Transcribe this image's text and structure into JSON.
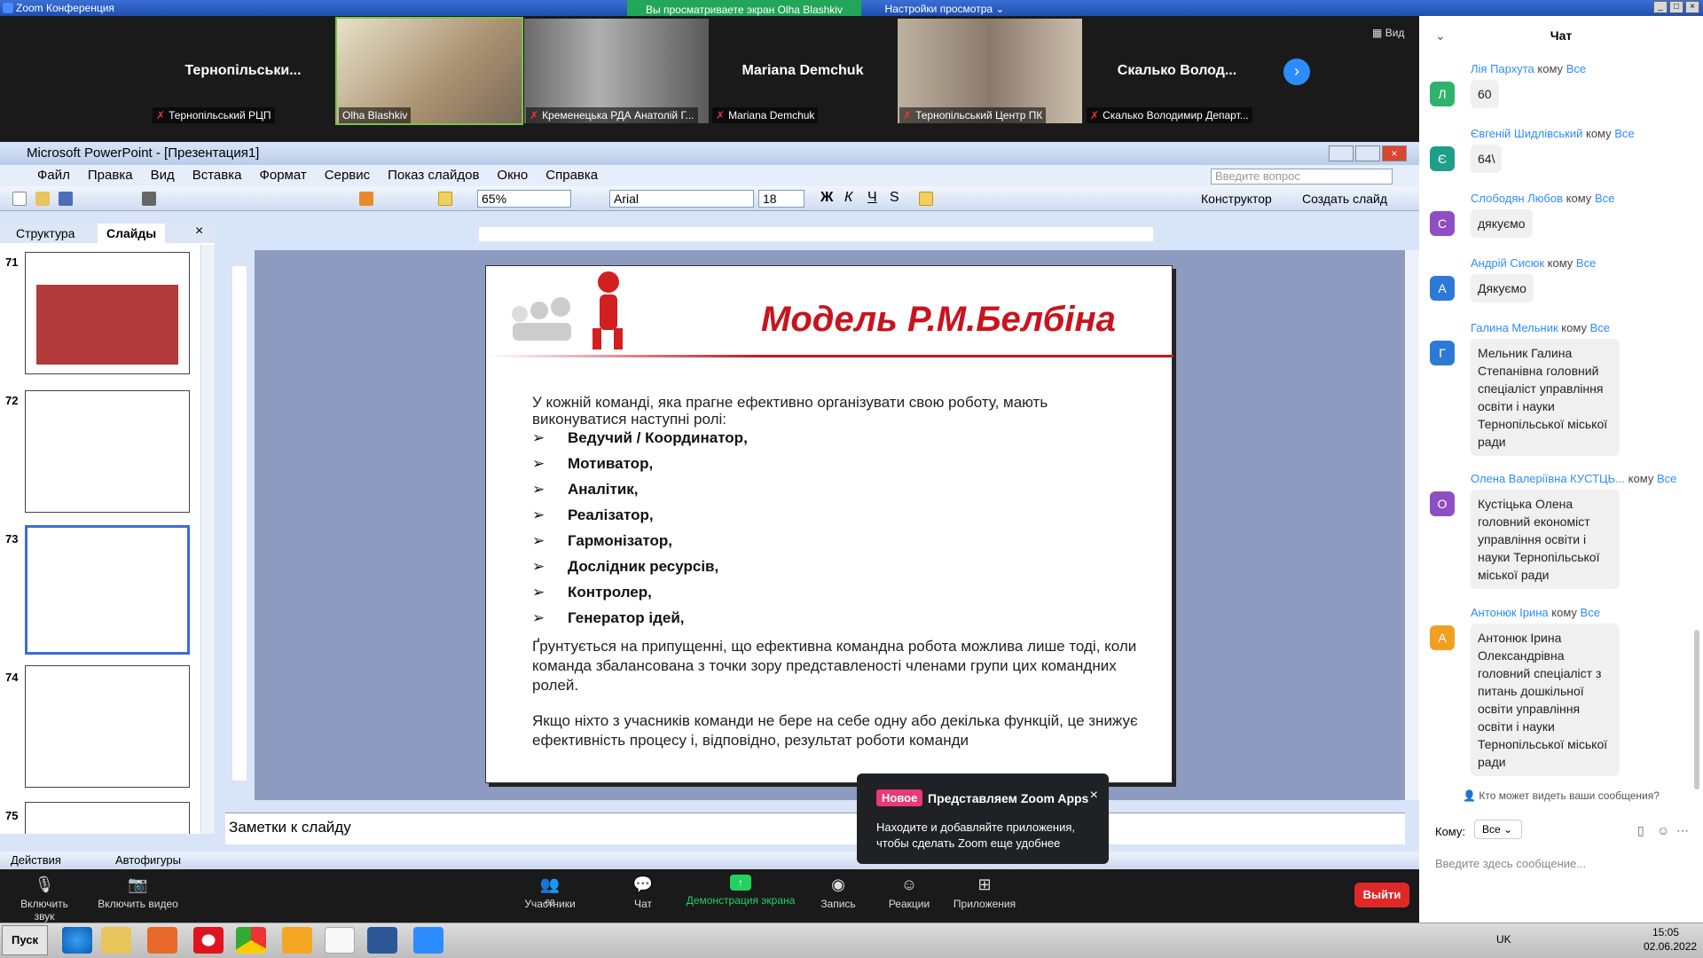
{
  "zoom": {
    "title": "Zoom Конференция",
    "share_banner": "Вы просматриваете экран Olha Blashkiv",
    "view_options": "Настройки просмотра",
    "view_label": "Вид"
  },
  "participants": [
    {
      "name": "Тернопільськи...",
      "label": "Тернопільський РЦП"
    },
    {
      "name": "",
      "label": "Olha Blashkiv"
    },
    {
      "name": "",
      "label": "Кременецька РДА Анатолій Г..."
    },
    {
      "name": "Mariana Demchuk",
      "label": "Mariana Demchuk"
    },
    {
      "name": "",
      "label": "Тернопільський Центр ПК"
    },
    {
      "name": "Скалько Волод...",
      "label": "Скалько Володимир Департ..."
    }
  ],
  "ppt": {
    "title": "Microsoft PowerPoint - [Презентация1]",
    "menu": [
      "Файл",
      "Правка",
      "Вид",
      "Вставка",
      "Формат",
      "Сервис",
      "Показ слайдов",
      "Окно",
      "Справка"
    ],
    "ask_placeholder": "Введите вопрос",
    "zoom": "65%",
    "font": "Arial",
    "size": "18",
    "designer": "Конструктор",
    "new_slide": "Создать слайд",
    "tabs": {
      "outline": "Структура",
      "slides": "Слайды"
    },
    "thumb_nums": [
      "71",
      "72",
      "73",
      "74",
      "75"
    ],
    "notes": "Заметки к слайду",
    "draw": {
      "actions": "Действия",
      "autoshapes": "Автофигуры"
    }
  },
  "slide": {
    "title": "Модель Р.М.Белбіна",
    "intro": "У кожній команді, яка прагне ефективно організувати свою роботу, мають виконуватися наступні ролі:",
    "roles": [
      "Ведучий / Координатор,",
      "Мотиватор,",
      "Аналітик,",
      "Реалізатор,",
      "Гармонізатор,",
      "Дослідник ресурсів,",
      "Контролер,",
      "Генератор ідей,"
    ],
    "para1": "Ґрунтується на припущенні, що ефективна командна робота можлива лише тоді, коли команда збалансована з точки зору представленості членами групи цих командних ролей.",
    "para2": "Якщо ніхто з учасників команди не бере на себе одну або декілька функцій, це знижує ефективність процесу і, відповідно, результат роботи команди"
  },
  "bottom": {
    "mute": "Включить звук",
    "video": "Включить видео",
    "participants": "Участники",
    "participants_count": "62",
    "chat": "Чат",
    "share": "Демонстрация экрана",
    "record": "Запись",
    "reactions": "Реакции",
    "apps": "Приложения",
    "leave": "Выйти"
  },
  "popup": {
    "badge": "Новое",
    "title": "Представляем Zoom Apps",
    "body": "Находите и добавляйте приложения, чтобы сделать Zoom еще удобнее"
  },
  "chat": {
    "header": "Чат",
    "messages": [
      {
        "from": "Лія Пархута",
        "to": "кому",
        "all": "Все",
        "text": "60",
        "initial": "Л",
        "color": "#2fb36b"
      },
      {
        "from": "Євгеній Шидлівський",
        "to": "кому",
        "all": "Все",
        "text": "64\\",
        "initial": "Є",
        "color": "#1f9e8a"
      },
      {
        "from": "Слободян  Любов",
        "to": "кому",
        "all": "Все",
        "text": "дякуємо",
        "initial": "С",
        "color": "#8e4fc4"
      },
      {
        "from": "Андрій Сисюк",
        "to": "кому",
        "all": "Все",
        "text": "Дякуємо",
        "initial": "А",
        "color": "#2d7ad6"
      },
      {
        "from": "Галина Мельник",
        "to": "кому",
        "all": "Все",
        "text": "Мельник Галина Степанівна головний спеціаліст управління освіти і науки Тернопільської міської ради",
        "initial": "Г",
        "color": "#2d7ad6"
      },
      {
        "from": "Олена  Валеріївна КУСТЦЬ...",
        "to": "кому",
        "all": "Все",
        "text": "Кустіцька Олена головний економіст управління освіти і науки Тернопільської міської ради",
        "initial": "О",
        "color": "#8e4fc4"
      },
      {
        "from": "Антонюк Ірина",
        "to": "кому",
        "all": "Все",
        "text": "Антонюк Ірина Олександрівна головний спеціаліст з питань дошкільної освіти  управління освіти і науки Тернопільської міської ради",
        "initial": "А",
        "color": "#f0a020"
      }
    ],
    "who_can": "Кто может видеть ваши сообщения?",
    "to_label": "Кому:",
    "to_value": "Все",
    "input_placeholder": "Введите здесь сообщение..."
  },
  "taskbar": {
    "start": "Пуск",
    "lang": "UK",
    "time": "15:05",
    "date": "02.06.2022"
  }
}
